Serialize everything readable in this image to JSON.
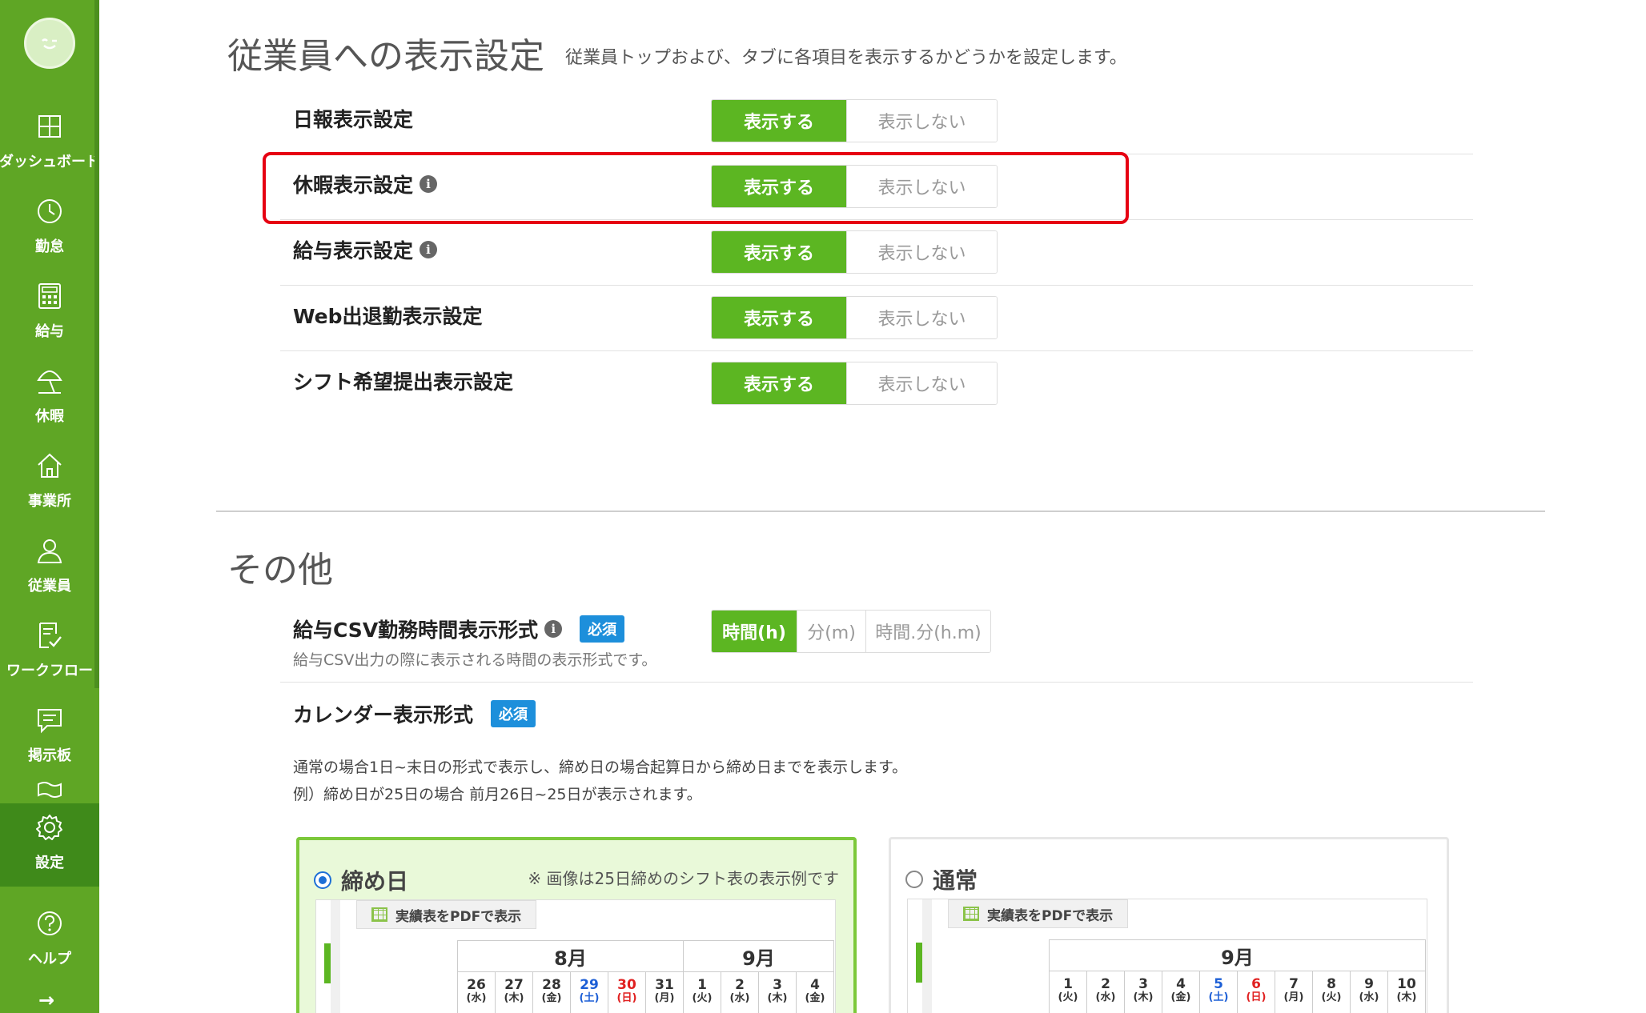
{
  "sidebar": {
    "items": [
      {
        "label": "ダッシュボード",
        "icon": "dashboard-icon"
      },
      {
        "label": "勤怠",
        "icon": "clock-icon"
      },
      {
        "label": "給与",
        "icon": "calculator-icon"
      },
      {
        "label": "休暇",
        "icon": "parasol-icon"
      },
      {
        "label": "事業所",
        "icon": "home-icon"
      },
      {
        "label": "従業員",
        "icon": "person-icon"
      },
      {
        "label": "ワークフロー",
        "icon": "workflow-icon"
      },
      {
        "label": "掲示板",
        "icon": "chat-icon"
      },
      {
        "label": "設定",
        "icon": "gear-icon"
      },
      {
        "label": "ヘルプ",
        "icon": "help-icon"
      }
    ],
    "expand_arrow": "→"
  },
  "display_settings": {
    "title": "従業員への表示設定",
    "description": "従業員トップおよび、タブに各項目を表示するかどうかを設定します。",
    "rows": [
      {
        "label": "日報表示設定",
        "on": "表示する",
        "off": "表示しない",
        "info": false
      },
      {
        "label": "休暇表示設定",
        "on": "表示する",
        "off": "表示しない",
        "info": true
      },
      {
        "label": "給与表示設定",
        "on": "表示する",
        "off": "表示しない",
        "info": true
      },
      {
        "label": "Web出退勤表示設定",
        "on": "表示する",
        "off": "表示しない",
        "info": false
      },
      {
        "label": "シフト希望提出表示設定",
        "on": "表示する",
        "off": "表示しない",
        "info": false
      }
    ]
  },
  "other": {
    "title": "その他",
    "csv_format": {
      "label": "給与CSV勤務時間表示形式",
      "badge": "必須",
      "description": "給与CSV出力の際に表示される時間の表示形式です。",
      "options": [
        "時間(h)",
        "分(m)",
        "時間.分(h.m)"
      ],
      "selected": "時間(h)"
    },
    "calendar_format": {
      "label": "カレンダー表示形式",
      "badge": "必須",
      "note_line1": "通常の場合1日~末日の形式で表示し、締め日の場合起算日から締め日までを表示します。",
      "note_line2": "例）締め日が25日の場合 前月26日~25日が表示されます。",
      "cards": [
        {
          "title": "締め日",
          "selected": true,
          "note": "※ 画像は25日締めのシフト表の表示例です",
          "pdf_button": "実績表をPDFで表示",
          "months": [
            {
              "label": "8月",
              "span": 6
            },
            {
              "label": "9月",
              "span": 4
            }
          ],
          "days": [
            {
              "d": "26",
              "w": "(水)",
              "t": ""
            },
            {
              "d": "27",
              "w": "(木)",
              "t": ""
            },
            {
              "d": "28",
              "w": "(金)",
              "t": ""
            },
            {
              "d": "29",
              "w": "(土)",
              "t": "sat"
            },
            {
              "d": "30",
              "w": "(日)",
              "t": "sun"
            },
            {
              "d": "31",
              "w": "(月)",
              "t": ""
            },
            {
              "d": "1",
              "w": "(火)",
              "t": ""
            },
            {
              "d": "2",
              "w": "(水)",
              "t": ""
            },
            {
              "d": "3",
              "w": "(木)",
              "t": ""
            },
            {
              "d": "4",
              "w": "(金)",
              "t": ""
            }
          ]
        },
        {
          "title": "通常",
          "selected": false,
          "note": "",
          "pdf_button": "実績表をPDFで表示",
          "months": [
            {
              "label": "9月",
              "span": 10
            }
          ],
          "days": [
            {
              "d": "1",
              "w": "(火)",
              "t": ""
            },
            {
              "d": "2",
              "w": "(水)",
              "t": ""
            },
            {
              "d": "3",
              "w": "(木)",
              "t": ""
            },
            {
              "d": "4",
              "w": "(金)",
              "t": ""
            },
            {
              "d": "5",
              "w": "(土)",
              "t": "sat"
            },
            {
              "d": "6",
              "w": "(日)",
              "t": "sun"
            },
            {
              "d": "7",
              "w": "(月)",
              "t": ""
            },
            {
              "d": "8",
              "w": "(火)",
              "t": ""
            },
            {
              "d": "9",
              "w": "(水)",
              "t": ""
            },
            {
              "d": "10",
              "w": "(木)",
              "t": ""
            }
          ]
        }
      ]
    }
  },
  "colors": {
    "sidebar": "#5fa625",
    "sidebar_active": "#3f8a1a",
    "toggle_on": "#5cb622",
    "badge": "#1d8fdb",
    "highlight": "#e60012"
  }
}
